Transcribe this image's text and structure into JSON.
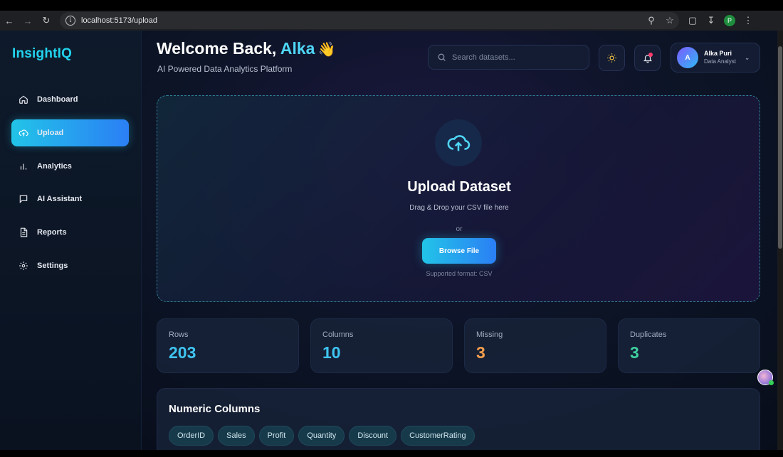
{
  "browser": {
    "url": "localhost:5173/upload",
    "profile_initial": "P"
  },
  "sidebar": {
    "logo": "InsightIQ",
    "items": [
      {
        "label": "Dashboard",
        "icon": "home-icon",
        "active": false
      },
      {
        "label": "Upload",
        "icon": "upload-cloud-icon",
        "active": true
      },
      {
        "label": "Analytics",
        "icon": "bar-chart-icon",
        "active": false
      },
      {
        "label": "AI Assistant",
        "icon": "chat-icon",
        "active": false
      },
      {
        "label": "Reports",
        "icon": "document-icon",
        "active": false
      },
      {
        "label": "Settings",
        "icon": "gear-icon",
        "active": false
      }
    ]
  },
  "header": {
    "welcome_prefix": "Welcome Back,",
    "welcome_name": "Alka",
    "wave": "👋",
    "subtitle": "AI Powered Data Analytics Platform",
    "search_placeholder": "Search datasets...",
    "user": {
      "initial": "A",
      "name": "Alka Puri",
      "role": "Data Analyst"
    }
  },
  "upload": {
    "title": "Upload Dataset",
    "hint": "Drag & Drop your CSV file here",
    "or": "or",
    "button": "Browse File",
    "supported": "Supported format: CSV"
  },
  "stats": [
    {
      "label": "Rows",
      "value": "203",
      "color": "#3fc4f0"
    },
    {
      "label": "Columns",
      "value": "10",
      "color": "#3fc4f0"
    },
    {
      "label": "Missing",
      "value": "3",
      "color": "#f59e4c"
    },
    {
      "label": "Duplicates",
      "value": "3",
      "color": "#3ed0a0"
    }
  ],
  "numeric": {
    "title": "Numeric Columns",
    "columns": [
      "OrderID",
      "Sales",
      "Profit",
      "Quantity",
      "Discount",
      "CustomerRating"
    ]
  },
  "colors": {
    "accent": "#22d3ee",
    "gradient_start": "#22c4e8",
    "gradient_end": "#2b7ff5"
  }
}
